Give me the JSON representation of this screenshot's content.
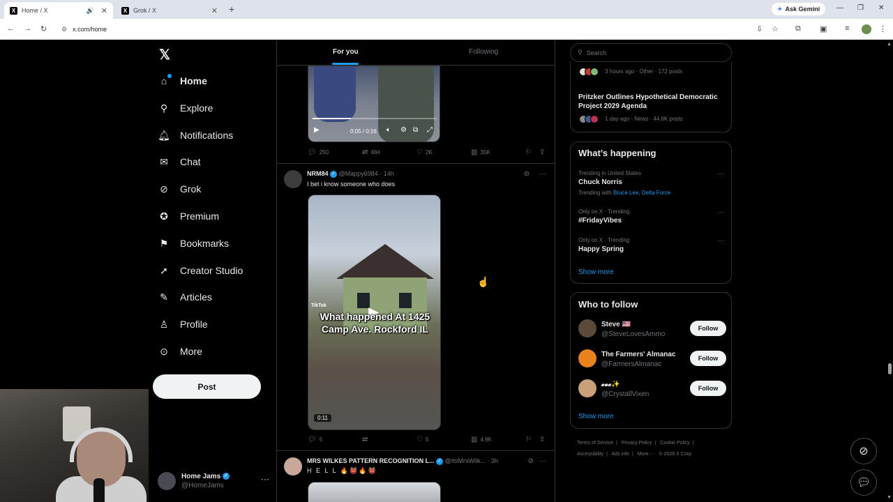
{
  "browser": {
    "tabs": [
      {
        "title": "Home / X",
        "icon": "x-logo-icon"
      },
      {
        "title": "Grok / X",
        "icon": "x-logo-icon"
      }
    ],
    "gemini_label": "Ask Gemini",
    "url": "x.com/home"
  },
  "sidebar": {
    "items": [
      {
        "label": "Home",
        "icon": "home-icon"
      },
      {
        "label": "Explore",
        "icon": "search-icon"
      },
      {
        "label": "Notifications",
        "icon": "bell-icon"
      },
      {
        "label": "Chat",
        "icon": "mail-icon"
      },
      {
        "label": "Grok",
        "icon": "grok-icon"
      },
      {
        "label": "Premium",
        "icon": "verified-icon"
      },
      {
        "label": "Bookmarks",
        "icon": "bookmark-icon"
      },
      {
        "label": "Creator Studio",
        "icon": "rocket-icon"
      },
      {
        "label": "Articles",
        "icon": "articles-icon"
      },
      {
        "label": "Profile",
        "icon": "person-icon"
      },
      {
        "label": "More",
        "icon": "more-circle-icon"
      }
    ],
    "post_label": "Post",
    "account": {
      "name": "Home Jams",
      "handle": "@HomeJams"
    }
  },
  "timeline": {
    "tabs": [
      "For you",
      "Following"
    ],
    "first_video": {
      "time": "0:05 / 0:16",
      "progress": 0.31
    },
    "first_actions": {
      "replies": "250",
      "reposts": "484",
      "likes": "2K",
      "views": "35K"
    },
    "tweet2": {
      "name": "NRM84",
      "handle": "@Mappy6984",
      "time": "· 14h",
      "text": "I bet i know someone who does",
      "overlay_text": "What happened At 1425 Camp Ave. Rockford IL",
      "tiktok_label": "TikTok",
      "duration": "0:11",
      "actions": {
        "replies": "5",
        "reposts": "",
        "likes": "5",
        "views": "4.9K"
      }
    },
    "tweet3": {
      "name": "MRS WILKES PATTERN RECOGNITION L...",
      "handle": "@ItsMrsWilk...",
      "time": "· 3h",
      "text": "H E L L 🔥👹🔥👹"
    }
  },
  "right": {
    "search_placeholder": "Search",
    "news": [
      {
        "meta": "3 hours ago · Other · 172 posts"
      },
      {
        "title": "Pritzker Outlines Hypothetical Democratic Project 2029 Agenda",
        "meta": "1 day ago · News · 44.6K posts"
      }
    ],
    "happening_title": "What’s happening",
    "trends": [
      {
        "context": "Trending in United States",
        "name": "Chuck Norris",
        "with_label": "Trending with",
        "with": "Bruce Lee, Delta Force"
      },
      {
        "context": "Only on X · Trending",
        "name": "#FridayVibes"
      },
      {
        "context": "Only on X · Trending",
        "name": "Happy Spring"
      }
    ],
    "show_more": "Show more",
    "wtf_title": "Who to follow",
    "follow_label": "Follow",
    "suggestions": [
      {
        "name": "Steve 🇺🇸",
        "handle": "@SteveLovesAmmo"
      },
      {
        "name": "The Farmers' Almanac",
        "handle": "@FarmersAlmanac"
      },
      {
        "name": "𝓮𝓿𝓮✨",
        "handle": "@CrystallVixen"
      }
    ],
    "footer": [
      "Terms of Service",
      "|",
      "Privacy Policy",
      "|",
      "Cookie Policy",
      "|",
      "Accessibility",
      "|",
      "Ads info",
      "|",
      "More ···",
      "© 2026 X Corp."
    ]
  }
}
